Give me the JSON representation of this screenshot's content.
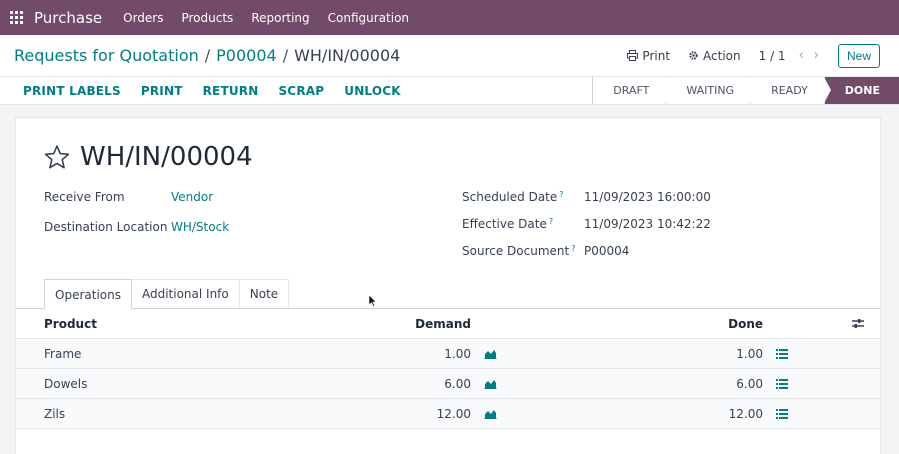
{
  "navbar": {
    "app_name": "Purchase",
    "menu": [
      "Orders",
      "Products",
      "Reporting",
      "Configuration"
    ],
    "bg_color": "#714b67"
  },
  "breadcrumb": {
    "items": [
      "Requests for Quotation",
      "P00004"
    ],
    "current": "WH/IN/00004"
  },
  "toolbar": {
    "print_label": "Print",
    "action_label": "Action",
    "pager": "1 / 1",
    "new_label": "New"
  },
  "statusbar": {
    "buttons": [
      "PRINT LABELS",
      "PRINT",
      "RETURN",
      "SCRAP",
      "UNLOCK"
    ],
    "stages": [
      "DRAFT",
      "WAITING",
      "READY",
      "DONE"
    ],
    "active_stage": "DONE"
  },
  "record": {
    "title": "WH/IN/00004",
    "left_fields": [
      {
        "label": "Receive From",
        "value": "Vendor"
      },
      {
        "label": "Destination Location",
        "value": "WH/Stock"
      }
    ],
    "right_fields": [
      {
        "label": "Scheduled Date",
        "value": "11/09/2023 16:00:00"
      },
      {
        "label": "Effective Date",
        "value": "11/09/2023 10:42:22"
      },
      {
        "label": "Source Document",
        "value": "P00004"
      }
    ]
  },
  "tabs": [
    "Operations",
    "Additional Info",
    "Note"
  ],
  "table": {
    "columns": [
      "Product",
      "Demand",
      "Done"
    ],
    "rows": [
      {
        "product": "Frame",
        "demand": "1.00",
        "done": "1.00"
      },
      {
        "product": "Dowels",
        "demand": "6.00",
        "done": "6.00"
      },
      {
        "product": "Zils",
        "demand": "12.00",
        "done": "12.00"
      }
    ]
  },
  "colors": {
    "accent": "#017e84",
    "brand": "#714b67"
  }
}
